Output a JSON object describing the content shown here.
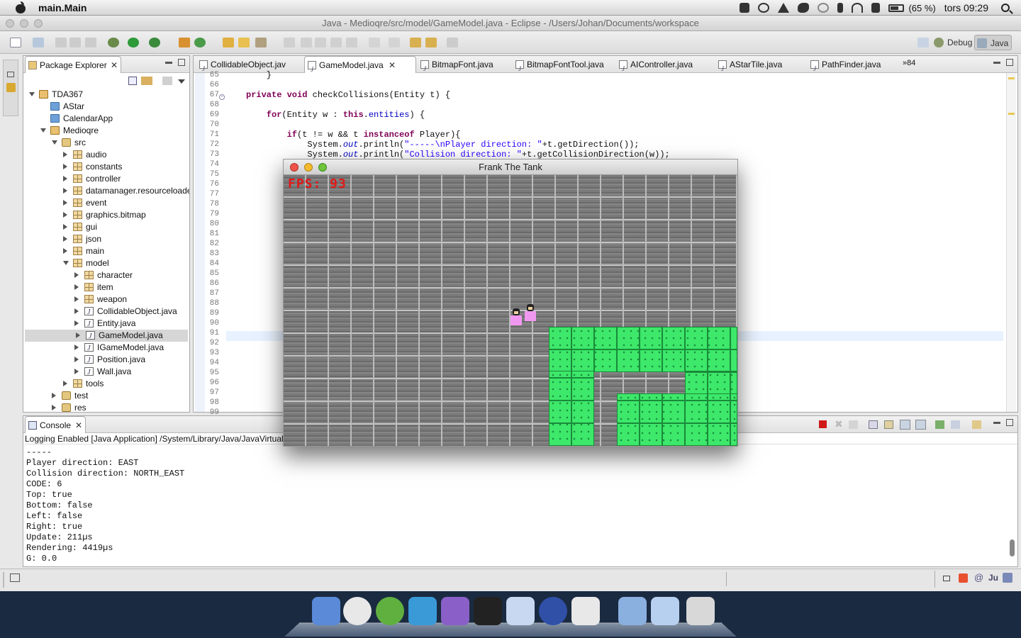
{
  "menubar": {
    "app_name": "main.Main",
    "battery": "(65 %)",
    "clock": "tors 09:29"
  },
  "window": {
    "title": "Java - Medioqre/src/model/GameModel.java - Eclipse - /Users/Johan/Documents/workspace"
  },
  "toolbar": {
    "debug_label": "Debug",
    "java_label": "Java"
  },
  "package_explorer": {
    "title": "Package Explorer",
    "tree": [
      {
        "label": "TDA367",
        "icon": "project",
        "depth": 0,
        "expanded": true
      },
      {
        "label": "AStar",
        "icon": "folder",
        "depth": 1
      },
      {
        "label": "CalendarApp",
        "icon": "folder",
        "depth": 1
      },
      {
        "label": "Medioqre",
        "icon": "project",
        "depth": 1,
        "expanded": true
      },
      {
        "label": "src",
        "icon": "source-folder",
        "depth": 2,
        "expanded": true
      },
      {
        "label": "audio",
        "icon": "package",
        "depth": 3,
        "expanded": false
      },
      {
        "label": "constants",
        "icon": "package",
        "depth": 3,
        "expanded": false
      },
      {
        "label": "controller",
        "icon": "package",
        "depth": 3,
        "expanded": false
      },
      {
        "label": "datamanager.resourceloade",
        "icon": "package",
        "depth": 3,
        "expanded": false
      },
      {
        "label": "event",
        "icon": "package",
        "depth": 3,
        "expanded": false
      },
      {
        "label": "graphics.bitmap",
        "icon": "package",
        "depth": 3,
        "expanded": false
      },
      {
        "label": "gui",
        "icon": "package",
        "depth": 3,
        "expanded": false
      },
      {
        "label": "json",
        "icon": "package",
        "depth": 3,
        "expanded": false
      },
      {
        "label": "main",
        "icon": "package",
        "depth": 3,
        "expanded": false
      },
      {
        "label": "model",
        "icon": "package",
        "depth": 3,
        "expanded": true
      },
      {
        "label": "character",
        "icon": "package",
        "depth": 4,
        "expanded": false
      },
      {
        "label": "item",
        "icon": "package",
        "depth": 4,
        "expanded": false
      },
      {
        "label": "weapon",
        "icon": "package",
        "depth": 4,
        "expanded": false
      },
      {
        "label": "CollidableObject.java",
        "icon": "java-file",
        "depth": 4,
        "expanded": false
      },
      {
        "label": "Entity.java",
        "icon": "java-file",
        "depth": 4,
        "expanded": false
      },
      {
        "label": "GameModel.java",
        "icon": "java-file",
        "depth": 4,
        "expanded": false,
        "selected": true
      },
      {
        "label": "IGameModel.java",
        "icon": "java-file",
        "depth": 4,
        "expanded": false
      },
      {
        "label": "Position.java",
        "icon": "java-file",
        "depth": 4,
        "expanded": false
      },
      {
        "label": "Wall.java",
        "icon": "java-file",
        "depth": 4,
        "expanded": false
      },
      {
        "label": "tools",
        "icon": "package",
        "depth": 3,
        "expanded": false
      },
      {
        "label": "test",
        "icon": "source-folder",
        "depth": 2,
        "expanded": false
      },
      {
        "label": "res",
        "icon": "source-folder",
        "depth": 2,
        "expanded": false
      }
    ]
  },
  "editor": {
    "tabs": [
      "CollidableObject.jav",
      "GameModel.java",
      "BitmapFont.java",
      "BitmapFontTool.java",
      "AIController.java",
      "AStarTile.java",
      "PathFinder.java"
    ],
    "active_tab": 1,
    "overflow": "84",
    "line_numbers": [
      "65",
      "66",
      "67",
      "68",
      "69",
      "70",
      "71",
      "72",
      "73",
      "74",
      "75",
      "76",
      "77",
      "78",
      "79",
      "80",
      "81",
      "82",
      "83",
      "84",
      "85",
      "86",
      "87",
      "88",
      "89",
      "90",
      "91",
      "92",
      "93",
      "94",
      "95",
      "96",
      "97",
      "98",
      "99"
    ],
    "code": [
      {
        "line": 0,
        "parts": [
          [
            "plain",
            "    }"
          ]
        ]
      },
      {
        "line": 2,
        "parts": [
          [
            "kw",
            "private void"
          ],
          [
            "plain",
            " checkCollisions(Entity t) {"
          ]
        ]
      },
      {
        "line": 4,
        "parts": [
          [
            "plain",
            "    "
          ],
          [
            "kw",
            "for"
          ],
          [
            "plain",
            "(Entity w : "
          ],
          [
            "kw",
            "this"
          ],
          [
            "plain",
            "."
          ],
          [
            "fld2",
            "entities"
          ],
          [
            "plain",
            ") {"
          ]
        ]
      },
      {
        "line": 6,
        "parts": [
          [
            "plain",
            "        "
          ],
          [
            "kw",
            "if"
          ],
          [
            "plain",
            "(t != w && t "
          ],
          [
            "kw",
            "instanceof"
          ],
          [
            "plain",
            " Player){"
          ]
        ]
      },
      {
        "line": 7,
        "parts": [
          [
            "plain",
            "            System."
          ],
          [
            "fld",
            "out"
          ],
          [
            "plain",
            ".println("
          ],
          [
            "str",
            "\"-----\\nPlayer direction: \""
          ],
          [
            "plain",
            "+t.getDirection());"
          ]
        ]
      },
      {
        "line": 8,
        "parts": [
          [
            "plain",
            "            System."
          ],
          [
            "fld",
            "out"
          ],
          [
            "plain",
            ".println("
          ],
          [
            "str",
            "\"Collision direction: \""
          ],
          [
            "plain",
            "+t.getCollisionDirection(w));"
          ]
        ]
      }
    ]
  },
  "console": {
    "title": "Console",
    "launch": "Logging Enabled [Java Application] /System/Library/Java/JavaVirtualI",
    "lines": [
      "-----",
      "Player direction: EAST",
      "Collision direction: NORTH_EAST",
      "CODE: 6",
      "Top: true",
      "Bottom: false",
      "Left: false",
      "Right: true",
      "Update: 211µs",
      "Rendering: 4419µs",
      "G: 0.0"
    ]
  },
  "game_window": {
    "title": "Frank The Tank",
    "fps_text": "FPS: 93"
  },
  "dock": {
    "apps": [
      "finder-icon",
      "chrome-icon",
      "spotify-icon",
      "twitter-icon",
      "system-preferences-icon",
      "terminal-icon",
      "mail-icon",
      "eclipse-icon",
      "coffee-icon",
      "applications-folder-icon",
      "documents-folder-icon",
      "trash-icon"
    ]
  }
}
